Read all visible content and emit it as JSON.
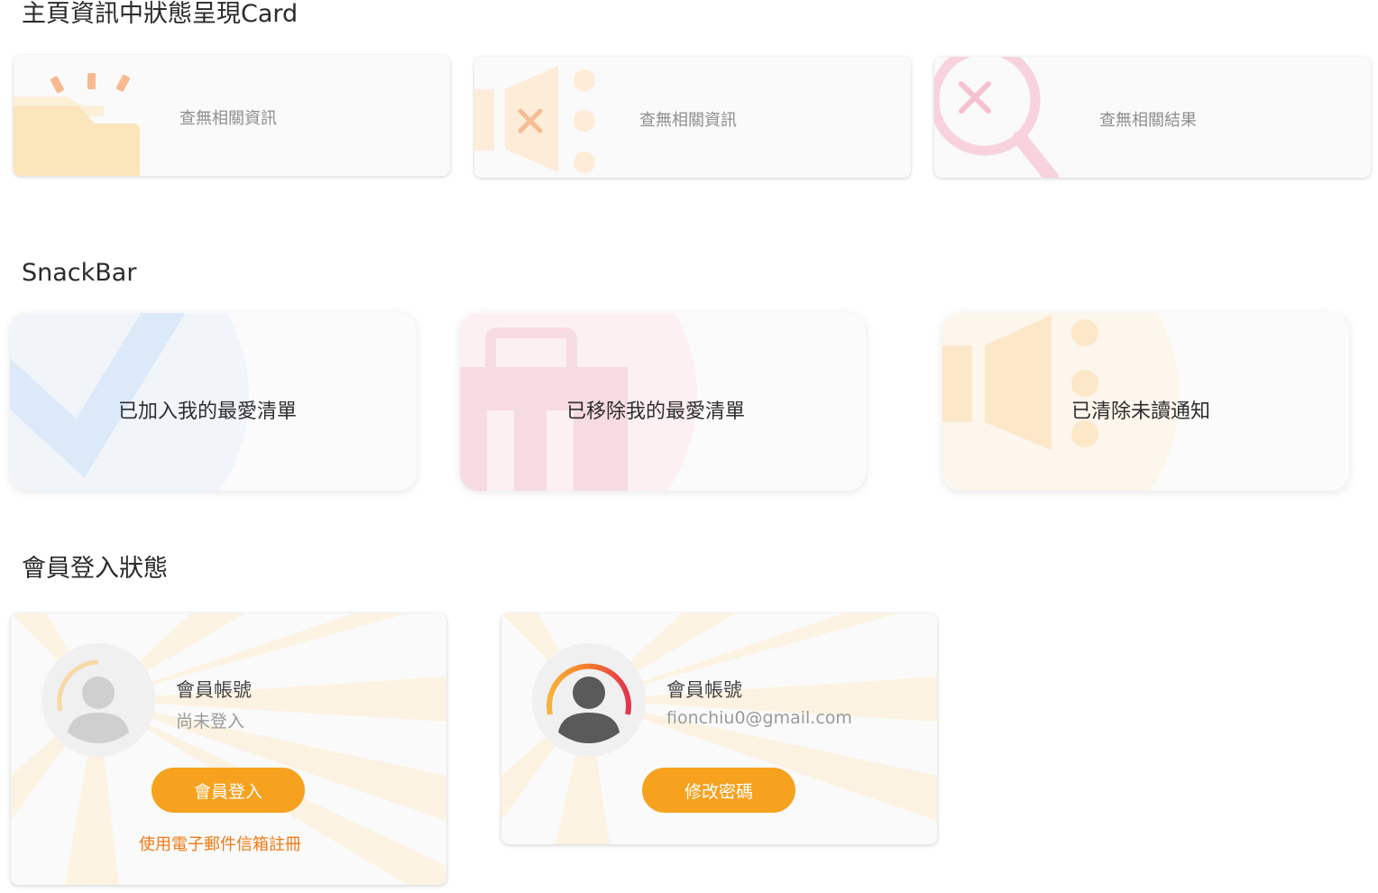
{
  "sections": {
    "cards_title": "主頁資訊中狀態呈現Card",
    "snackbar_title": "SnackBar",
    "member_title": "會員登入狀態"
  },
  "empty_cards": [
    {
      "message": "查無相關資訊",
      "icon": "folder-icon"
    },
    {
      "message": "查無相關資訊",
      "icon": "speaker-icon"
    },
    {
      "message": "查無相關結果",
      "icon": "search-x-icon"
    }
  ],
  "snackbars": [
    {
      "message": "已加入我的最愛清單",
      "icon": "check-icon"
    },
    {
      "message": "已移除我的最愛清單",
      "icon": "trash-icon"
    },
    {
      "message": "已清除未讀通知",
      "icon": "speaker-icon"
    }
  ],
  "member_logged_out": {
    "name": "會員帳號",
    "status": "尚未登入",
    "button": "會員登入",
    "link": "使用電子郵件信箱註冊"
  },
  "member_logged_in": {
    "name": "會員帳號",
    "email": "fionchiu0@gmail.com",
    "button": "修改密碼"
  },
  "colors": {
    "accent": "#f6a21e",
    "link": "#f07a12",
    "folder": "#fbe6bc",
    "pink": "#f5c1cf",
    "blue": "#d8e7f8"
  }
}
